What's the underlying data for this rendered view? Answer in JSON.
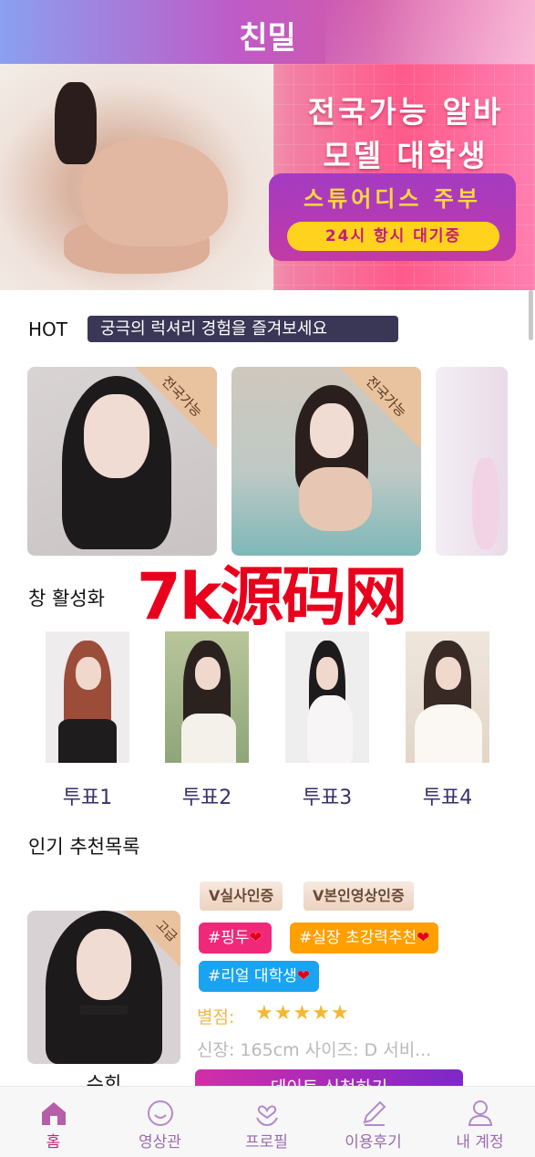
{
  "header": {
    "title": "친밀"
  },
  "banner": {
    "line1": "전국가능 알바",
    "line2": "모델 대학생",
    "line3": "스튜어디스 주부",
    "pill": "24시 항시 대기중"
  },
  "hot": {
    "label": "HOT",
    "tagline": "궁극의 럭셔리 경험을 즐겨보세요",
    "cards": [
      {
        "corner": "전국가능"
      },
      {
        "corner": "전국가능"
      }
    ]
  },
  "watermark": "7k源码网",
  "vote_section": {
    "title": "창 활성화",
    "items": [
      {
        "label": "투표1"
      },
      {
        "label": "투표2"
      },
      {
        "label": "투표3"
      },
      {
        "label": "투표4"
      }
    ]
  },
  "recommend": {
    "title": "인기 추천목록",
    "corner": "고급",
    "name": "수희",
    "badges": [
      "V실사인증",
      "V본인영상인증"
    ],
    "tags": [
      "#핑두",
      "#실장 초강력추천",
      "#리얼 대학생"
    ],
    "rating_label": "별점:",
    "rating_stars": 5,
    "spec": "신장: 165cm 사이즈: D 서비...",
    "cta": "데이트 신청하기"
  },
  "tabbar": {
    "items": [
      {
        "label": "홈",
        "icon": "home-icon"
      },
      {
        "label": "영상관",
        "icon": "smile-icon"
      },
      {
        "label": "프로필",
        "icon": "heart-hands-icon"
      },
      {
        "label": "이용후기",
        "icon": "pencil-icon"
      },
      {
        "label": "내 계정",
        "icon": "user-icon"
      }
    ]
  },
  "colors": {
    "accent": "#c0267e",
    "tab_icon": "#9b6bb0",
    "tag_pink": "#f0287a",
    "tag_orange": "#ff9f00",
    "tag_blue": "#1aa3f0",
    "star": "#f5b731"
  }
}
